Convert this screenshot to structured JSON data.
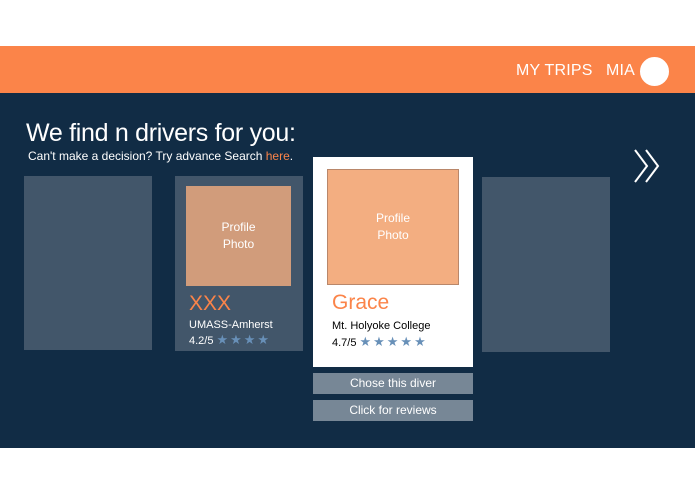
{
  "header": {
    "my_trips_label": "MY TRIPS",
    "user_name": "MIA",
    "bar_color": "#fb8449"
  },
  "main": {
    "heading": "We find n drivers for you:",
    "subtext": "Can't make a decision? Try advance Search ",
    "subtext_link": "here",
    "subtext_end": ".",
    "background": "#112c45"
  },
  "drivers": [
    {
      "photo_label": "Profile\nPhoto",
      "name": "XXX",
      "school": "UMASS-Amherst",
      "rating": "4.2/5",
      "stars": "★★★★"
    },
    {
      "photo_label": "Profile\nPhoto",
      "name": "Grace",
      "school": "Mt. Holyoke College",
      "rating": "4.7/5",
      "stars": "★★★★★"
    }
  ],
  "actions": {
    "choose_label": "Chose this diver",
    "reviews_label": "Click for reviews"
  },
  "icons": {
    "next": "double-chevron-right-icon"
  }
}
